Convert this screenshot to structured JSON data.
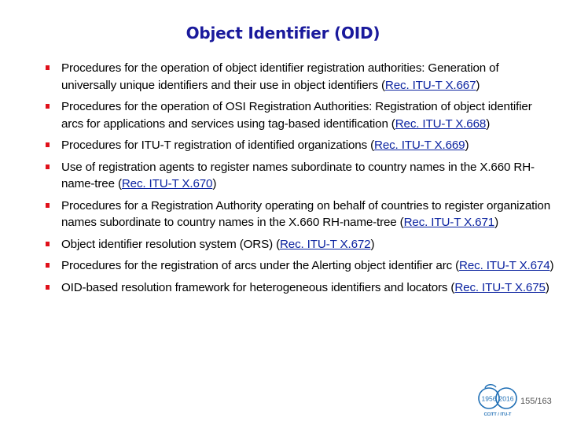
{
  "slide": {
    "title": "Object Identifier (OID)",
    "bullets": [
      {
        "text": "Procedures for the operation of object identifier registration authorities: Generation of universally unique identifiers and their use in object identifiers (",
        "link": "Rec. ITU-T X.667",
        "suffix": ")"
      },
      {
        "text": "Procedures for the operation of OSI Registration Authorities: Registration of object identifier arcs for applications and services using tag-based identification (",
        "link": "Rec. ITU-T X.668",
        "suffix": ")"
      },
      {
        "text": "Procedures for ITU-T registration of identified organizations (",
        "link": "Rec. ITU-T X.669",
        "suffix": ")"
      },
      {
        "text": "Use of registration agents to register names subordinate to country names in the X.660 RH-name-tree (",
        "link": "Rec. ITU-T X.670",
        "suffix": ")"
      },
      {
        "text": "Procedures for a Registration Authority operating on behalf of countries to register organization names subordinate to country names in the X.660 RH-name-tree (",
        "link": "Rec. ITU-T X.671",
        "suffix": ")"
      },
      {
        "text": "Object identifier resolution system (ORS) (",
        "link": "Rec. ITU-T X.672",
        "suffix": ")"
      },
      {
        "text": "Procedures for the registration of arcs under the Alerting object identifier arc (",
        "link": "Rec. ITU-T X.674",
        "suffix": ")"
      },
      {
        "text": "OID-based resolution framework for heterogeneous identifiers and locators (",
        "link": "Rec. ITU-T X.675",
        "suffix": ")"
      }
    ]
  },
  "footer": {
    "logo": {
      "year_start": "1956",
      "year_end": "2016",
      "caption": "CCITT / ITU-T",
      "icon": "itu-60th-anniversary-logo"
    },
    "page_current": "155",
    "page_total": "163",
    "page_separator": "/"
  },
  "colors": {
    "title": "#1a1a9c",
    "bullet": "#e0101a",
    "link": "#0b23a0",
    "logo": "#1f6fb5"
  }
}
